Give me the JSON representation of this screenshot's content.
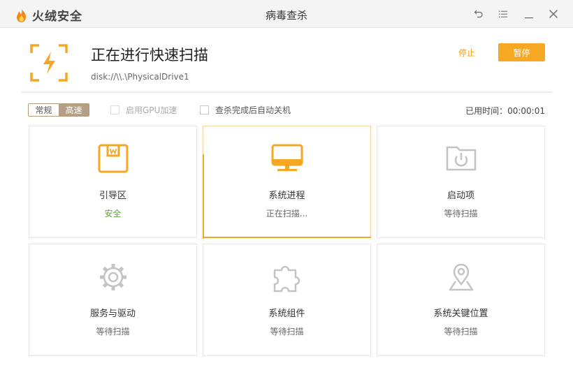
{
  "titlebar": {
    "brand": "火绒安全",
    "title": "病毒查杀",
    "icons": [
      "back-icon",
      "menu-icon",
      "minimize-icon",
      "close-icon"
    ]
  },
  "header": {
    "title": "正在进行快速扫描",
    "path": "disk://\\\\.\\PhysicalDrive1",
    "stop_label": "停止",
    "pause_label": "暂停"
  },
  "options": {
    "mode_normal": "常规",
    "mode_fast": "高速",
    "selected_mode": "高速",
    "gpu_label": "启用GPU加速",
    "gpu_checked": false,
    "shutdown_label": "查杀完成后自动关机",
    "shutdown_checked": false,
    "elapsed": "已用时间：00:00:01"
  },
  "cards": [
    {
      "name": "引导区",
      "status": "安全",
      "icon": "boot-sector-icon"
    },
    {
      "name": "系统进程",
      "status": "正在扫描...",
      "icon": "monitor-icon"
    },
    {
      "name": "启动项",
      "status": "等待扫描",
      "icon": "startup-folder-icon"
    },
    {
      "name": "服务与驱动",
      "status": "等待扫描",
      "icon": "gear-icon"
    },
    {
      "name": "系统组件",
      "status": "等待扫描",
      "icon": "puzzle-icon"
    },
    {
      "name": "系统关键位置",
      "status": "等待扫描",
      "icon": "location-pin-icon"
    }
  ],
  "colors": {
    "accent": "#f5a623",
    "safe": "#5aa832",
    "inactive_icon": "#c4c4c4",
    "mode_selected": "#b4a085"
  }
}
